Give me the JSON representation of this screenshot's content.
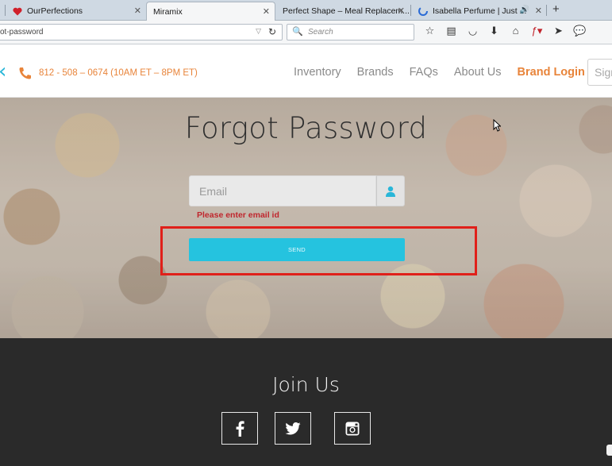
{
  "browser": {
    "tabs": [
      {
        "title": "OurPerfections"
      },
      {
        "title": "Miramix",
        "active": true
      },
      {
        "title": "Perfect Shape – Meal Replacem..."
      },
      {
        "title": "Isabella Perfume | Just ..."
      }
    ],
    "url": "ot-password",
    "search_placeholder": "Search",
    "icons": [
      "star-icon",
      "reading-list-icon",
      "pocket-icon",
      "download-icon",
      "home-icon",
      "flash-icon",
      "send-icon",
      "chat-icon"
    ]
  },
  "header": {
    "phone": "812 - 508 – 0674 (10AM ET – 8PM ET)",
    "menu": [
      "Inventory",
      "Brands",
      "FAQs",
      "About Us"
    ],
    "brand_login": "Brand Login",
    "sign_label": "Sign"
  },
  "main": {
    "title": "Forgot Password",
    "email_placeholder": "Email",
    "error": "Please enter email id",
    "send_label": "SEND"
  },
  "footer": {
    "join_title": "Join Us",
    "social": [
      "facebook-icon",
      "twitter-icon",
      "instagram-icon"
    ]
  },
  "colors": {
    "accent": "#25c3df",
    "brand_orange": "#e8843a",
    "error": "#c0262d",
    "highlight": "#e0201a",
    "footer_bg": "#2a2a2a"
  }
}
